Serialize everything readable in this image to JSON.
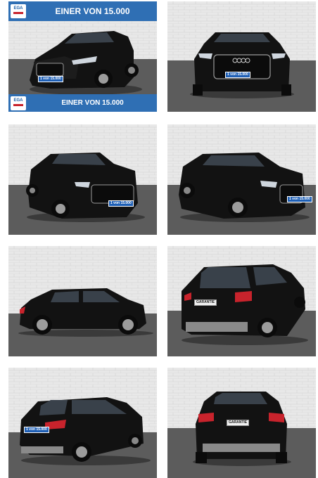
{
  "gallery": {
    "promo_banner_top": "EINER VON 15.000",
    "promo_banner_bottom": "EINER VON 15.000",
    "logo_text": "EGA",
    "plate_text": "1 von 15.000",
    "guarantee_plate_text": "GARANTIE",
    "colors": {
      "banner": "#2f6fb4",
      "wall": "#e6e6e6",
      "floor": "#5a5a5a",
      "car": "#111111"
    }
  }
}
